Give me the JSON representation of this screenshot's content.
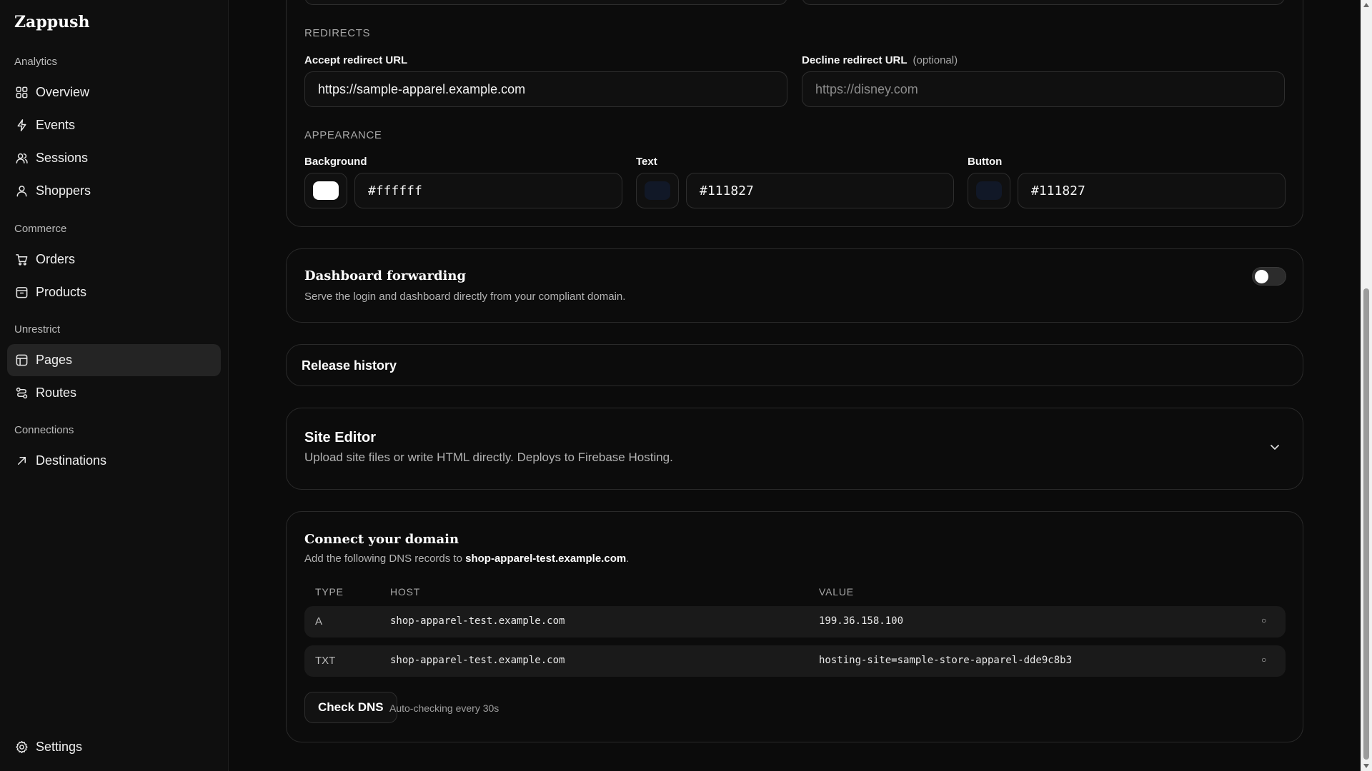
{
  "brand": "Zappush",
  "sidebar": {
    "sections": [
      {
        "label": "Analytics",
        "items": [
          {
            "label": "Overview",
            "icon": "grid-icon"
          },
          {
            "label": "Events",
            "icon": "bolt-icon"
          },
          {
            "label": "Sessions",
            "icon": "users-icon"
          },
          {
            "label": "Shoppers",
            "icon": "user-icon"
          }
        ]
      },
      {
        "label": "Commerce",
        "items": [
          {
            "label": "Orders",
            "icon": "cart-icon"
          },
          {
            "label": "Products",
            "icon": "box-icon"
          }
        ]
      },
      {
        "label": "Unrestrict",
        "items": [
          {
            "label": "Pages",
            "icon": "pages-icon",
            "active": true
          },
          {
            "label": "Routes",
            "icon": "routes-icon"
          }
        ]
      },
      {
        "label": "Connections",
        "items": [
          {
            "label": "Destinations",
            "icon": "arrow-up-right-icon"
          }
        ]
      }
    ],
    "settings": {
      "label": "Settings",
      "icon": "gear-icon"
    }
  },
  "redirects": {
    "section_label": "REDIRECTS",
    "accept_label": "Accept redirect URL",
    "accept_value": "https://sample-apparel.example.com",
    "decline_label": "Decline redirect URL",
    "decline_optional": "(optional)",
    "decline_placeholder": "https://disney.com"
  },
  "appearance": {
    "section_label": "APPEARANCE",
    "background": {
      "label": "Background",
      "value": "#ffffff",
      "color": "#ffffff"
    },
    "text": {
      "label": "Text",
      "value": "#111827",
      "color": "#111827"
    },
    "button": {
      "label": "Button",
      "value": "#111827",
      "color": "#111827"
    }
  },
  "dashboard_forwarding": {
    "title": "Dashboard forwarding",
    "description": "Serve the login and dashboard directly from your compliant domain.",
    "enabled": false
  },
  "release_history": {
    "title": "Release history"
  },
  "site_editor": {
    "title": "Site Editor",
    "description": "Upload site files or write HTML directly. Deploys to Firebase Hosting."
  },
  "domain": {
    "title": "Connect your domain",
    "desc_prefix": "Add the following DNS records to ",
    "desc_domain": "shop-apparel-test.example.com",
    "desc_suffix": ".",
    "columns": [
      "TYPE",
      "HOST",
      "VALUE"
    ],
    "rows": [
      {
        "type": "A",
        "host": "shop-apparel-test.example.com",
        "value": "199.36.158.100",
        "status": "○"
      },
      {
        "type": "TXT",
        "host": "shop-apparel-test.example.com",
        "value": "hosting-site=sample-store-apparel-dde9c8b3",
        "status": "○"
      }
    ],
    "check_button": "Check DNS",
    "auto_hint": "Auto-checking every 30s"
  }
}
